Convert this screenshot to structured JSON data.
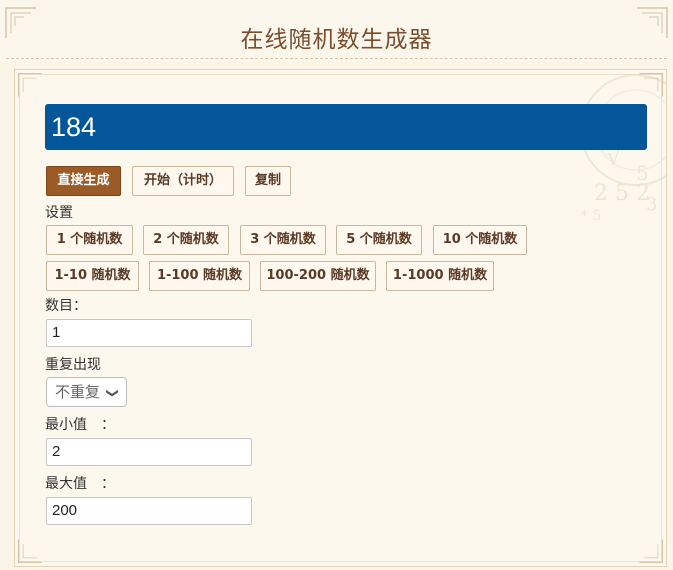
{
  "header": {
    "title": "在线随机数生成器"
  },
  "result": {
    "value": "184"
  },
  "actions": {
    "direct_generate": "直接生成",
    "start_timer": "开始（计时）",
    "copy": "复制"
  },
  "settings": {
    "label": "设置",
    "count_presets": [
      "1 个随机数",
      "2 个随机数",
      "3 个随机数",
      "5 个随机数",
      "10 个随机数"
    ],
    "range_presets": [
      "1-10 随机数",
      "1-100 随机数",
      "100-200 随机数",
      "1-1000 随机数"
    ]
  },
  "form": {
    "count_label": "数目：",
    "count_value": "1",
    "repeat_label": "重复出现",
    "repeat_value": "不重复",
    "min_label": "最小值　：",
    "min_value": "2",
    "max_label": "最大值　：",
    "max_value": "200"
  },
  "theme": {
    "accent": "#9b5b26",
    "result_bg": "#03569a",
    "title_color": "#7a4e2c"
  }
}
